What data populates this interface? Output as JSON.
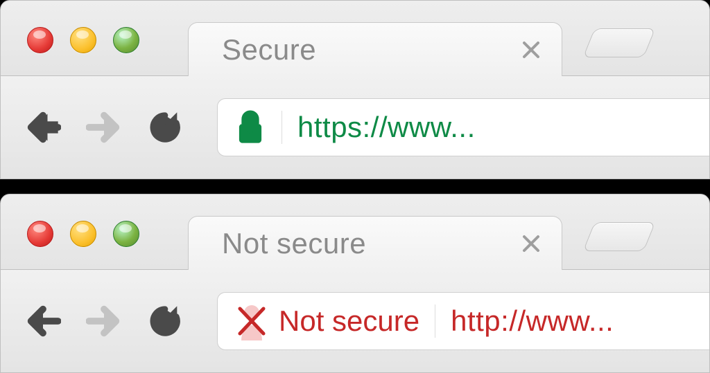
{
  "browsers": [
    {
      "traffic_light_colors": [
        "red",
        "yellow",
        "green"
      ],
      "tab_title": "Secure",
      "security_state": "secure",
      "url_text": "https://www...",
      "security_label": ""
    },
    {
      "traffic_light_colors": [
        "red",
        "yellow",
        "green"
      ],
      "tab_title": "Not secure",
      "security_state": "not-secure",
      "url_text": "http://www...",
      "security_label": "Not secure"
    }
  ],
  "colors": {
    "secure": "#0e8a46",
    "insecure": "#c62828"
  }
}
